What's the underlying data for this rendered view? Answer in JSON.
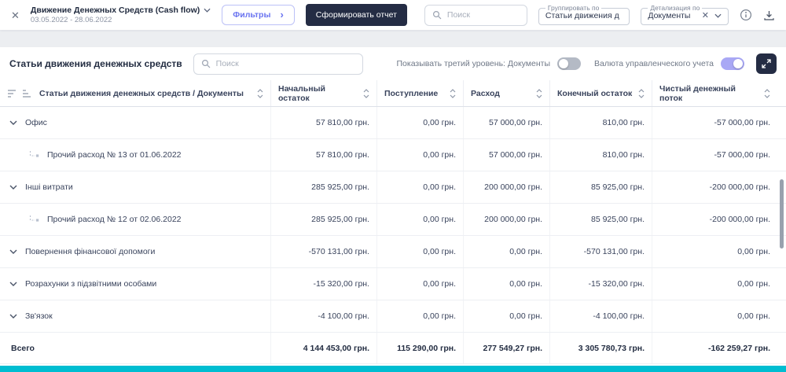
{
  "topbar": {
    "close_icon": "✕",
    "title": "Движение Денежных Средств (Cash flow)",
    "date_range": "03.05.2022 - 28.06.2022",
    "filters_button_label": "Фильтры",
    "filters_button_chevron": "›",
    "generate_button_label": "Сформировать отчет",
    "search_placeholder": "Поиск",
    "group_by": {
      "label": "Группировать по",
      "value": "Статьи движения д"
    },
    "detail_by": {
      "label": "Детализация по",
      "value": "Документы",
      "clear_icon": "✕"
    }
  },
  "panel": {
    "title": "Статьи движения денежных средств",
    "search_placeholder": "Поиск",
    "third_level_toggle_label": "Показывать третий уровень: Документы",
    "third_level_toggle_on": false,
    "currency_toggle_label": "Валюта управленческого учета",
    "currency_toggle_on": true
  },
  "table": {
    "columns": [
      "Статьи движения денежных средств / Документы",
      "Начальный остаток",
      "Поступление",
      "Расход",
      "Конечный остаток",
      "Чистый денежный поток"
    ],
    "rows": [
      {
        "label": "Офис",
        "level": 0,
        "values": [
          "57 810,00 грн.",
          "0,00 грн.",
          "57 000,00 грн.",
          "810,00 грн.",
          "-57 000,00 грн."
        ]
      },
      {
        "label": "Прочий расход № 13 от 01.06.2022",
        "level": 1,
        "values": [
          "57 810,00 грн.",
          "0,00 грн.",
          "57 000,00 грн.",
          "810,00 грн.",
          "-57 000,00 грн."
        ]
      },
      {
        "label": "Інші витрати",
        "level": 0,
        "values": [
          "285 925,00 грн.",
          "0,00 грн.",
          "200 000,00 грн.",
          "85 925,00 грн.",
          "-200 000,00 грн."
        ]
      },
      {
        "label": "Прочий расход № 12 от 02.06.2022",
        "level": 1,
        "values": [
          "285 925,00 грн.",
          "0,00 грн.",
          "200 000,00 грн.",
          "85 925,00 грн.",
          "-200 000,00 грн."
        ]
      },
      {
        "label": "Повернення фінансової допомоги",
        "level": 0,
        "values": [
          "-570 131,00 грн.",
          "0,00 грн.",
          "0,00 грн.",
          "-570 131,00 грн.",
          "0,00 грн."
        ]
      },
      {
        "label": "Розрахунки з підзвітними особами",
        "level": 0,
        "values": [
          "-15 320,00 грн.",
          "0,00 грн.",
          "0,00 грн.",
          "-15 320,00 грн.",
          "0,00 грн."
        ]
      },
      {
        "label": "Зв'язок",
        "level": 0,
        "values": [
          "-4 100,00 грн.",
          "0,00 грн.",
          "0,00 грн.",
          "-4 100,00 грн.",
          "0,00 грн."
        ]
      }
    ],
    "footer": {
      "label": "Всего",
      "values": [
        "4 144 453,00 грн.",
        "115 290,00 грн.",
        "277 549,27 грн.",
        "3 305 780,73 грн.",
        "-162 259,27 грн."
      ]
    }
  },
  "colors": {
    "accent_purple": "#6a74f0",
    "dark_navy": "#242c44",
    "teal": "#00bdd1"
  }
}
